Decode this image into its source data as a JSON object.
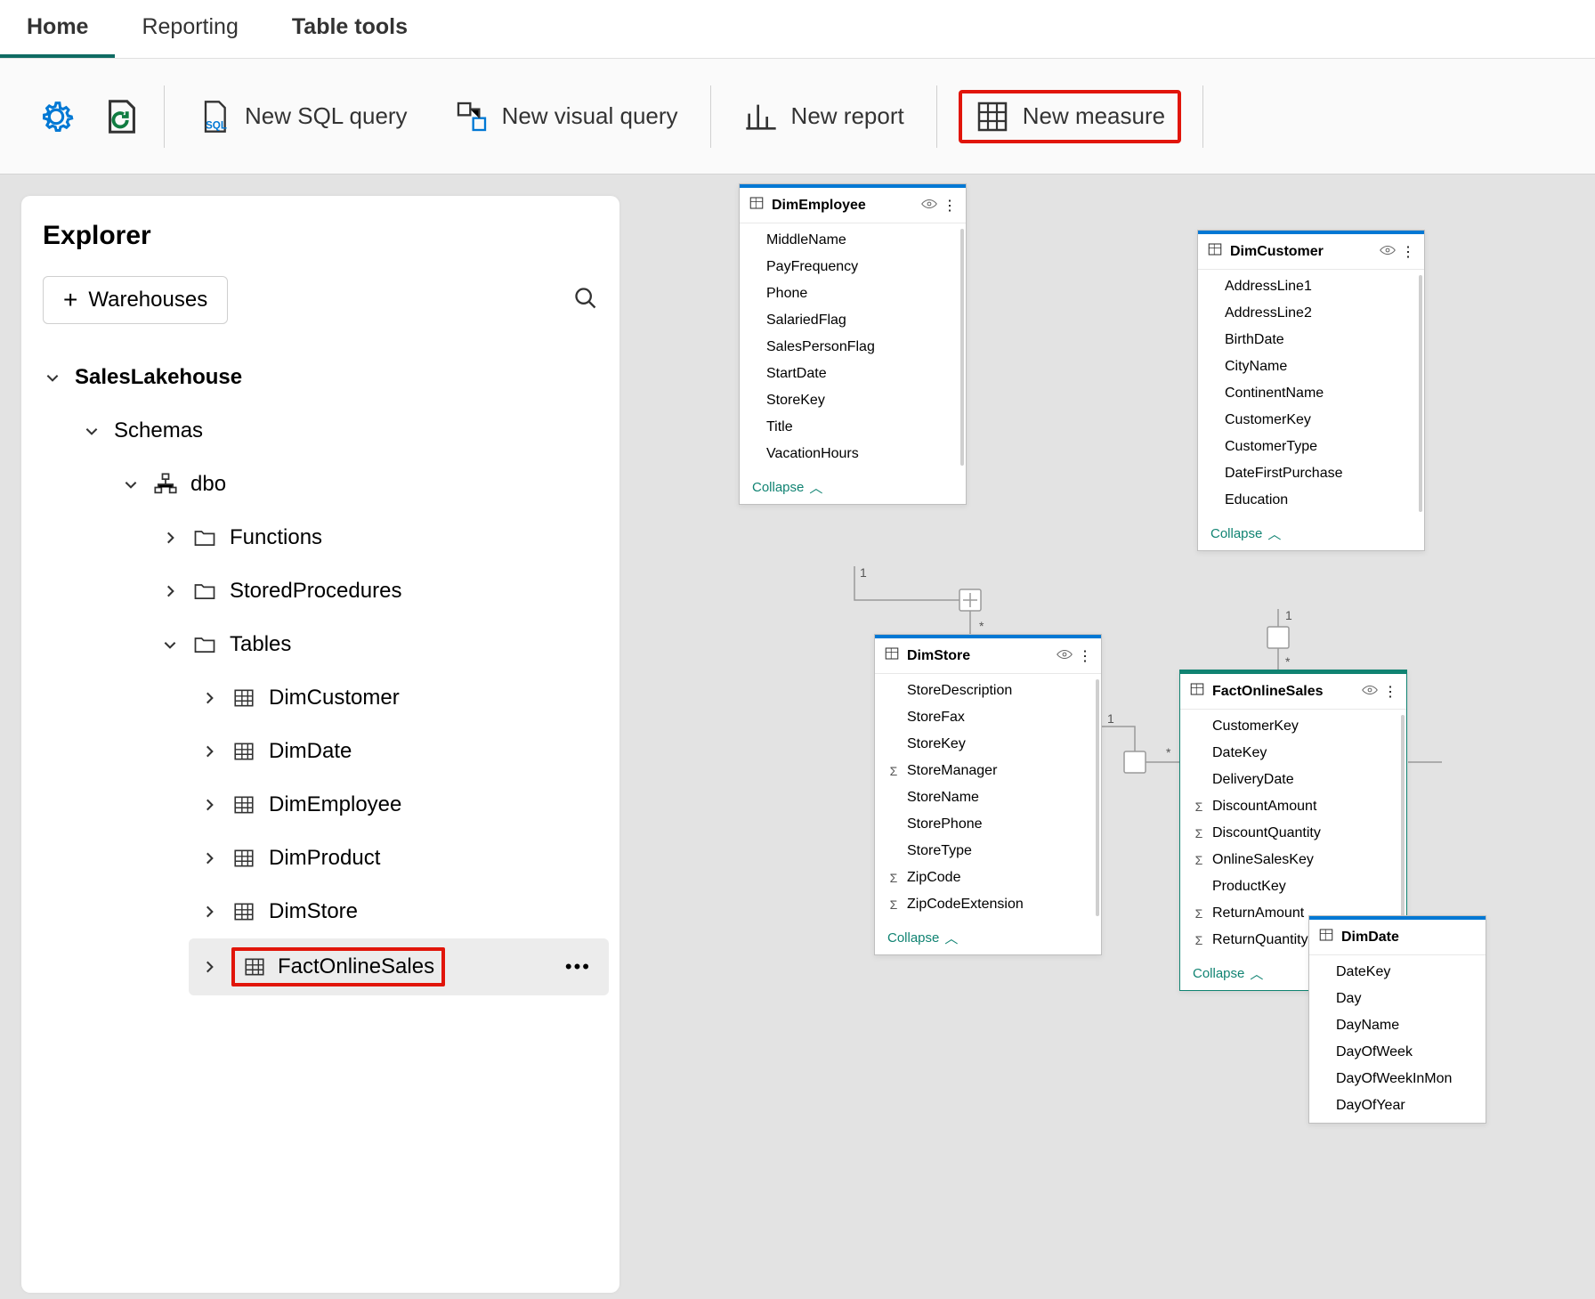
{
  "tabs": {
    "home": "Home",
    "reporting": "Reporting",
    "table_tools": "Table tools",
    "active": "home",
    "highlighted": "table_tools"
  },
  "toolbar": {
    "new_sql_query": "New SQL query",
    "new_visual_query": "New visual query",
    "new_report": "New report",
    "new_measure": "New measure"
  },
  "explorer": {
    "title": "Explorer",
    "warehouses_label": "Warehouses",
    "root": "SalesLakehouse",
    "schemas_label": "Schemas",
    "schema_name": "dbo",
    "folders": {
      "functions": "Functions",
      "stored_procedures": "StoredProcedures",
      "tables": "Tables"
    },
    "tables": [
      "DimCustomer",
      "DimDate",
      "DimEmployee",
      "DimProduct",
      "DimStore",
      "FactOnlineSales"
    ],
    "selected_table": "FactOnlineSales"
  },
  "diagram": {
    "collapse_label": "Collapse",
    "dim_employee": {
      "name": "DimEmployee",
      "columns": [
        "MiddleName",
        "PayFrequency",
        "Phone",
        "SalariedFlag",
        "SalesPersonFlag",
        "StartDate",
        "StoreKey",
        "Title",
        "VacationHours"
      ]
    },
    "dim_customer": {
      "name": "DimCustomer",
      "columns": [
        "AddressLine1",
        "AddressLine2",
        "BirthDate",
        "CityName",
        "ContinentName",
        "CustomerKey",
        "CustomerType",
        "DateFirstPurchase",
        "Education"
      ]
    },
    "dim_store": {
      "name": "DimStore",
      "columns": [
        {
          "n": "StoreDescription"
        },
        {
          "n": "StoreFax"
        },
        {
          "n": "StoreKey"
        },
        {
          "n": "StoreManager",
          "sigma": true
        },
        {
          "n": "StoreName"
        },
        {
          "n": "StorePhone"
        },
        {
          "n": "StoreType"
        },
        {
          "n": "ZipCode",
          "sigma": true
        },
        {
          "n": "ZipCodeExtension",
          "sigma": true
        }
      ]
    },
    "fact_online_sales": {
      "name": "FactOnlineSales",
      "columns": [
        {
          "n": "CustomerKey"
        },
        {
          "n": "DateKey"
        },
        {
          "n": "DeliveryDate"
        },
        {
          "n": "DiscountAmount",
          "sigma": true
        },
        {
          "n": "DiscountQuantity",
          "sigma": true
        },
        {
          "n": "OnlineSalesKey",
          "sigma": true
        },
        {
          "n": "ProductKey"
        },
        {
          "n": "ReturnAmount",
          "sigma": true
        },
        {
          "n": "ReturnQuantity",
          "sigma": true
        }
      ]
    },
    "dim_date": {
      "name": "DimDate",
      "columns": [
        "DateKey",
        "Day",
        "DayName",
        "DayOfWeek",
        "DayOfWeekInMon",
        "DayOfYear"
      ]
    }
  }
}
